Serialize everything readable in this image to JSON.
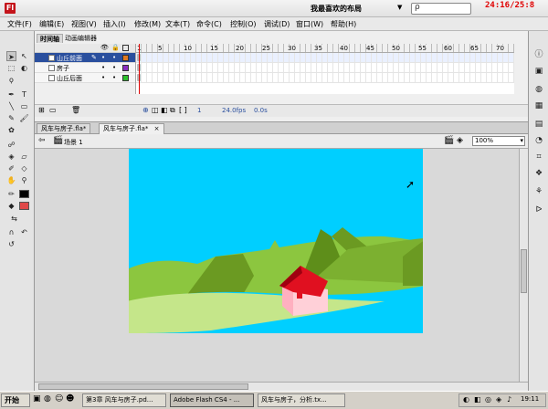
{
  "window": {
    "logo": "Fl",
    "layout_label": "我最喜欢的布局",
    "clock": "24:16/25:8"
  },
  "menu": [
    "文件(F)",
    "编辑(E)",
    "视图(V)",
    "插入(I)",
    "修改(M)",
    "文本(T)",
    "命令(C)",
    "控制(O)",
    "调试(D)",
    "窗口(W)",
    "帮助(H)"
  ],
  "timeline": {
    "tabs": [
      "时间轴",
      "动画编辑器"
    ],
    "frame_numbers": [
      "1",
      "5",
      "10",
      "15",
      "20",
      "25",
      "30",
      "35",
      "40",
      "45",
      "50",
      "55",
      "60",
      "65",
      "70",
      "75",
      "80",
      "85",
      "90"
    ],
    "layers": [
      {
        "name": "山丘前面",
        "color": "#e07820",
        "active": true
      },
      {
        "name": "房子",
        "color": "#8a2ec0",
        "active": false
      },
      {
        "name": "山丘后面",
        "color": "#2cc02c",
        "active": false
      }
    ],
    "current_frame": "1",
    "fps": "24.0fps",
    "time": "0.0s"
  },
  "document_tabs": [
    "风车与房子.fla*",
    "风车与房子.fla*"
  ],
  "scene_label": "场景 1",
  "zoom": "100%",
  "taskbar": {
    "start": "开始",
    "tasks": [
      "第3章 风车与房子.pd...",
      "Adobe Flash CS4 - ...",
      "风车与房子，分析.tx..."
    ],
    "clock": "19:11"
  },
  "colors": {
    "stage_sky": "#00cfff",
    "hill_light": "#8cc63f",
    "hill_dark": "#6b9a22",
    "ground": "#c5e68a",
    "roof": "#e01020",
    "wall": "#ffd0d8",
    "flash_red": "#c4141b"
  }
}
